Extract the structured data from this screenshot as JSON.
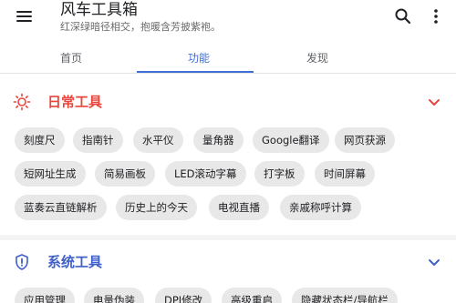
{
  "app": {
    "title": "风车工具箱",
    "subtitle": "红深绿暗径相交，抱暖含芳披紫袍。"
  },
  "tabs": [
    {
      "label": "首页",
      "selected": false
    },
    {
      "label": "功能",
      "selected": true
    },
    {
      "label": "发现",
      "selected": false
    }
  ],
  "sections": [
    {
      "title": "日常工具",
      "icon": "sun-icon",
      "color": "#e8453c",
      "expanded": true,
      "chips": [
        "刻度尺",
        "指南针",
        "水平仪",
        "量角器",
        "Google翻译",
        "网页获源",
        "短网址生成",
        "简易画板",
        "LED滚动字幕",
        "打字板",
        "时间屏幕",
        "蓝奏云直链解析",
        "历史上的今天",
        "电视直播",
        "亲戚称呼计算"
      ]
    },
    {
      "title": "系统工具",
      "icon": "shield-icon",
      "color": "#3f5fc9",
      "expanded": true,
      "chips": [
        "应用管理",
        "电量伪装",
        "DPI修改",
        "高级重启",
        "隐藏状态栏/导航栏"
      ]
    }
  ],
  "colors": {
    "accent": "#3f6fd8",
    "chip_background": "#e8e8e8"
  }
}
